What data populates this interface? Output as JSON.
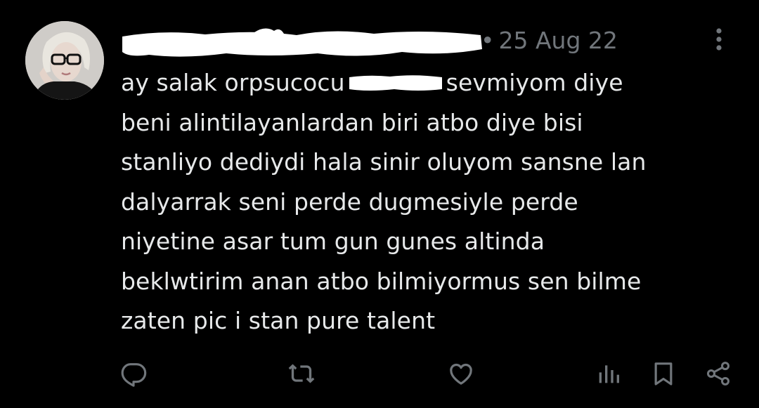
{
  "tweet": {
    "date": "25 Aug 22",
    "separator": "•",
    "text_lines": [
      {
        "before": "ay salak orpsucocu",
        "after": "sevmiyom diye"
      },
      {
        "text": "beni alintilayanlardan biri atbo diye bisi"
      },
      {
        "text": "stanliyo dediydi hala sinir oluyom sansne lan"
      },
      {
        "text": "dalyarrak seni perde dugmesiyle perde"
      },
      {
        "text": "niyetine asar tum gun gunes altinda"
      },
      {
        "text": "beklwtirim anan atbo bilmiyormus sen bilme"
      },
      {
        "text": "zaten pic i stan pure talent"
      }
    ]
  },
  "actions": {
    "icons": [
      "reply-icon",
      "retweet-icon",
      "like-icon",
      "views-icon",
      "bookmark-icon",
      "share-icon"
    ]
  },
  "colors": {
    "background": "#000000",
    "text": "#e7e9ea",
    "secondary": "#71767b",
    "redaction": "#ffffff"
  }
}
